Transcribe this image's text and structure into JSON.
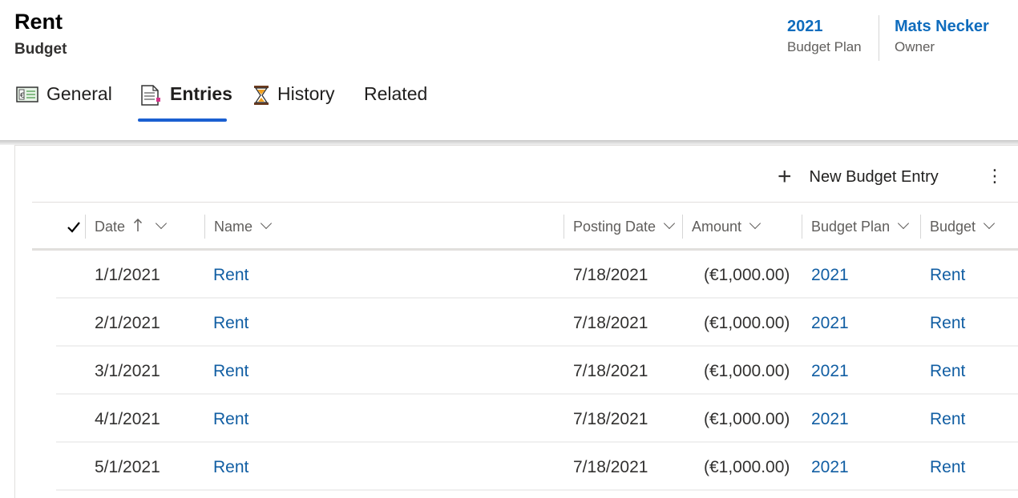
{
  "record": {
    "title": "Rent",
    "entity": "Budget"
  },
  "header_fields": [
    {
      "value": "2021",
      "label": "Budget Plan"
    },
    {
      "value": "Mats Necker",
      "label": "Owner"
    }
  ],
  "tabs": [
    {
      "label": "General",
      "icon": "budget-card-icon"
    },
    {
      "label": "Entries",
      "icon": "document-icon",
      "active": true
    },
    {
      "label": "History",
      "icon": "hourglass-icon"
    },
    {
      "label": "Related"
    }
  ],
  "commands": {
    "new_entry_label": "New Budget Entry",
    "more_label": "⋮"
  },
  "columns": [
    {
      "label": "Date",
      "sorted": "ascending"
    },
    {
      "label": "Name"
    },
    {
      "label": "Posting Date"
    },
    {
      "label": "Amount"
    },
    {
      "label": "Budget Plan"
    },
    {
      "label": "Budget"
    }
  ],
  "rows": [
    {
      "date": "1/1/2021",
      "name": "Rent",
      "posting_date": "7/18/2021",
      "amount": "(€1,000.00)",
      "budget_plan": "2021",
      "budget": "Rent"
    },
    {
      "date": "2/1/2021",
      "name": "Rent",
      "posting_date": "7/18/2021",
      "amount": "(€1,000.00)",
      "budget_plan": "2021",
      "budget": "Rent"
    },
    {
      "date": "3/1/2021",
      "name": "Rent",
      "posting_date": "7/18/2021",
      "amount": "(€1,000.00)",
      "budget_plan": "2021",
      "budget": "Rent"
    },
    {
      "date": "4/1/2021",
      "name": "Rent",
      "posting_date": "7/18/2021",
      "amount": "(€1,000.00)",
      "budget_plan": "2021",
      "budget": "Rent"
    },
    {
      "date": "5/1/2021",
      "name": "Rent",
      "posting_date": "7/18/2021",
      "amount": "(€1,000.00)",
      "budget_plan": "2021",
      "budget": "Rent"
    }
  ],
  "colors": {
    "accent": "#1a5fd1",
    "link": "#115ea3",
    "header_value": "#0f6cbd"
  }
}
